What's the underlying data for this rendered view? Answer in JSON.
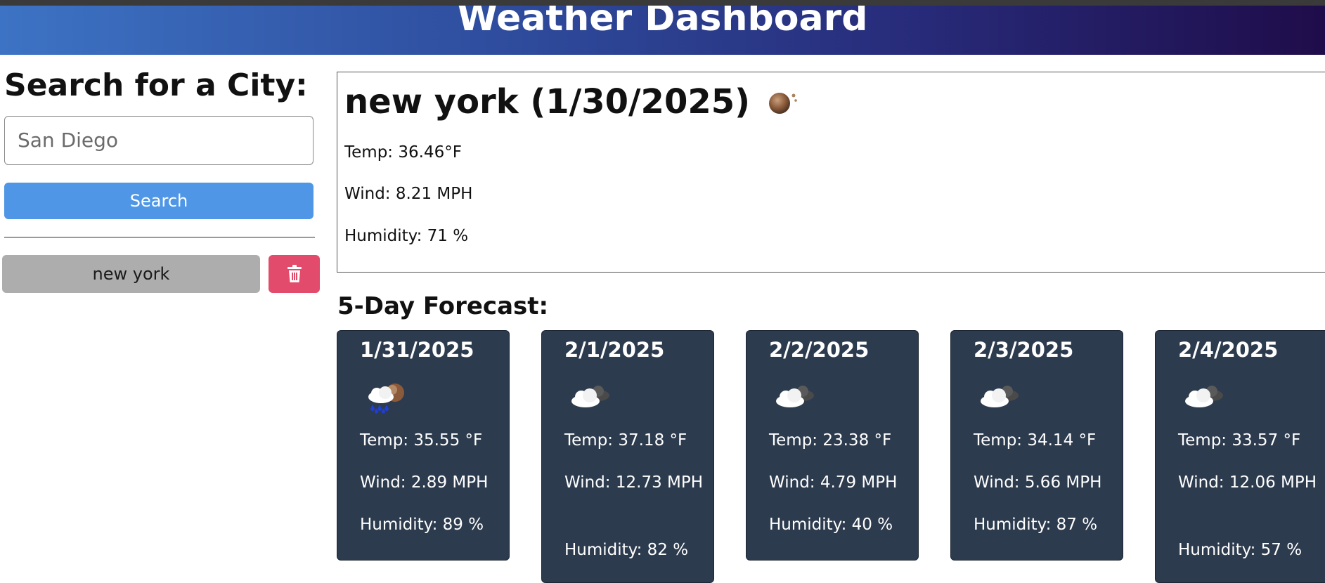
{
  "header": {
    "title": "Weather Dashboard"
  },
  "search": {
    "heading": "Search for a City:",
    "input_placeholder": "San Diego",
    "button_label": "Search"
  },
  "history": {
    "items": [
      {
        "label": "new york"
      }
    ],
    "delete_icon": "trash-icon"
  },
  "current": {
    "title": "new york (1/30/2025)",
    "icon": "night-clear-icon",
    "temp": "Temp: 36.46°F",
    "wind": "Wind: 8.21 MPH",
    "humidity": "Humidity: 71 %"
  },
  "forecast": {
    "heading": "5-Day Forecast:",
    "days": [
      {
        "date": "1/31/2025",
        "icon": "rain-night-icon",
        "temp": "Temp: 35.55 °F",
        "wind": "Wind: 2.89 MPH",
        "humidity": "Humidity: 89 %"
      },
      {
        "date": "2/1/2025",
        "icon": "partly-cloudy-night-icon",
        "temp": "Temp: 37.18 °F",
        "wind": "Wind: 12.73 MPH",
        "humidity": "Humidity: 82 %"
      },
      {
        "date": "2/2/2025",
        "icon": "partly-cloudy-night-icon",
        "temp": "Temp: 23.38 °F",
        "wind": "Wind: 4.79 MPH",
        "humidity": "Humidity: 40 %"
      },
      {
        "date": "2/3/2025",
        "icon": "partly-cloudy-night-icon",
        "temp": "Temp: 34.14 °F",
        "wind": "Wind: 5.66 MPH",
        "humidity": "Humidity: 87 %"
      },
      {
        "date": "2/4/2025",
        "icon": "partly-cloudy-night-icon",
        "temp": "Temp: 33.57 °F",
        "wind": "Wind: 12.06 MPH",
        "humidity": "Humidity: 57 %"
      }
    ]
  },
  "colors": {
    "header_gradient_start": "#3d73c4",
    "header_gradient_end": "#1f0c4a",
    "search_button": "#4f97e6",
    "history_button": "#adadad",
    "delete_button": "#e24b6b",
    "forecast_card": "#2d3b4e"
  }
}
